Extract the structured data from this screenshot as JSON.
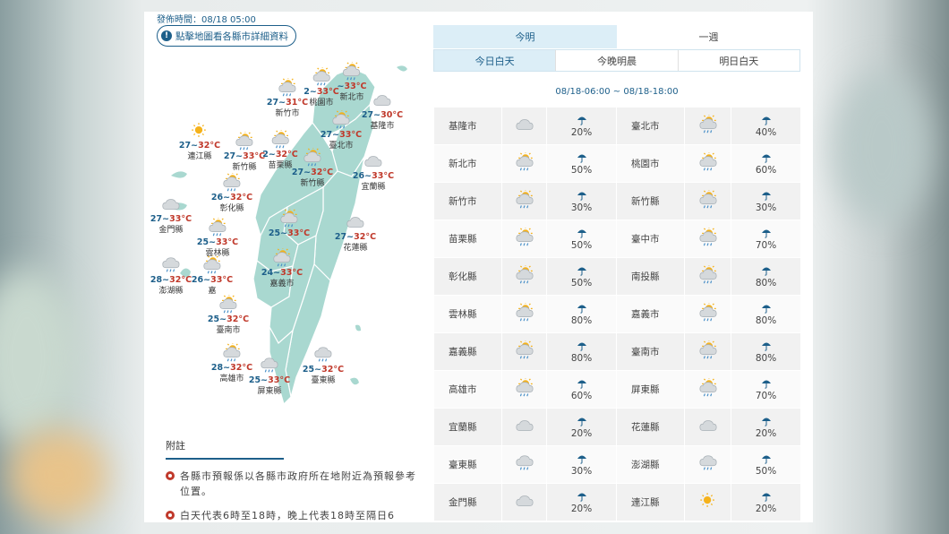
{
  "issue_time": "發佈時間：08/18 05:00",
  "map_hint": "點擊地圖看各縣市詳細資料",
  "tabs_top": [
    {
      "label": "今明",
      "active": true
    },
    {
      "label": "一週",
      "active": false
    }
  ],
  "tabs_period": [
    {
      "label": "今日白天",
      "active": true
    },
    {
      "label": "今晚明晨",
      "active": false
    },
    {
      "label": "明日白天",
      "active": false
    }
  ],
  "time_range": "08/18-06:00 ~ 08/18-18:00",
  "map_cities": [
    {
      "name": "新竹市",
      "lo": "27",
      "hi": "31",
      "icon": "sun-cloud-rain-icon"
    },
    {
      "name": "桃園市",
      "lo": "2",
      "hi": "33",
      "icon": "sun-cloud-rain-icon"
    },
    {
      "name": "新北市",
      "lo": "",
      "hi": "33",
      "icon": "sun-cloud-rain-icon"
    },
    {
      "name": "基隆市",
      "lo": "27",
      "hi": "30",
      "icon": "cloud-icon"
    },
    {
      "name": "臺北市",
      "lo": "27",
      "hi": "33",
      "icon": "sun-cloud-rain-icon"
    },
    {
      "name": "連江縣",
      "lo": "27",
      "hi": "32",
      "icon": "sun-icon"
    },
    {
      "name": "新竹縣",
      "lo": "27",
      "hi": "33",
      "icon": "sun-cloud-rain-icon"
    },
    {
      "name": "苗栗縣",
      "lo": "2",
      "hi": "32",
      "icon": "sun-cloud-rain-icon"
    },
    {
      "name": "新竹縣",
      "lo": "27",
      "hi": "32",
      "icon": "sun-cloud-rain-icon"
    },
    {
      "name": "宜蘭縣",
      "lo": "26",
      "hi": "33",
      "icon": "cloud-icon"
    },
    {
      "name": "彰化縣",
      "lo": "26",
      "hi": "32",
      "icon": "sun-cloud-rain-icon"
    },
    {
      "name": "金門縣",
      "lo": "27",
      "hi": "33",
      "icon": "cloud-icon"
    },
    {
      "name": "雲林縣",
      "lo": "25",
      "hi": "33",
      "icon": "sun-cloud-rain-icon"
    },
    {
      "name": "",
      "lo": "25",
      "hi": "33",
      "icon": "sun-cloud-rain-icon"
    },
    {
      "name": "花蓮縣",
      "lo": "27",
      "hi": "32",
      "icon": "cloud-icon"
    },
    {
      "name": "澎湖縣",
      "lo": "28",
      "hi": "32",
      "icon": "cloud-rain-icon"
    },
    {
      "name": "嘉",
      "lo": "26",
      "hi": "33",
      "icon": "sun-cloud-rain-icon"
    },
    {
      "name": "嘉義市",
      "lo": "24",
      "hi": "33",
      "icon": "sun-cloud-rain-icon"
    },
    {
      "name": "臺南市",
      "lo": "25",
      "hi": "32",
      "icon": "sun-cloud-rain-icon"
    },
    {
      "name": "高雄市",
      "lo": "28",
      "hi": "32",
      "icon": "sun-cloud-rain-icon"
    },
    {
      "name": "屏東縣",
      "lo": "25",
      "hi": "33",
      "icon": "cloud-rain-icon"
    },
    {
      "name": "臺東縣",
      "lo": "25",
      "hi": "32",
      "icon": "cloud-rain-icon"
    }
  ],
  "notes_title": "附註",
  "notes": [
    "各縣市預報係以各縣市政府所在地附近為預報參考位置。",
    "白天代表6時至18時，晚上代表18時至隔日6"
  ],
  "forecast_rows": [
    [
      {
        "name": "基隆市",
        "icon": "cloud-icon",
        "pop": "20%"
      },
      {
        "name": "臺北市",
        "icon": "sun-cloud-rain-icon",
        "pop": "40%"
      }
    ],
    [
      {
        "name": "新北市",
        "icon": "sun-cloud-rain-icon",
        "pop": "50%"
      },
      {
        "name": "桃園市",
        "icon": "sun-cloud-rain-icon",
        "pop": "60%"
      }
    ],
    [
      {
        "name": "新竹市",
        "icon": "sun-cloud-rain-icon",
        "pop": "30%"
      },
      {
        "name": "新竹縣",
        "icon": "sun-cloud-rain-icon",
        "pop": "30%"
      }
    ],
    [
      {
        "name": "苗栗縣",
        "icon": "sun-cloud-rain-icon",
        "pop": "50%"
      },
      {
        "name": "臺中市",
        "icon": "sun-cloud-rain-icon",
        "pop": "70%"
      }
    ],
    [
      {
        "name": "彰化縣",
        "icon": "sun-cloud-rain-icon",
        "pop": "50%"
      },
      {
        "name": "南投縣",
        "icon": "sun-cloud-rain-icon",
        "pop": "80%"
      }
    ],
    [
      {
        "name": "雲林縣",
        "icon": "sun-cloud-rain-icon",
        "pop": "80%"
      },
      {
        "name": "嘉義市",
        "icon": "sun-cloud-rain-icon",
        "pop": "80%"
      }
    ],
    [
      {
        "name": "嘉義縣",
        "icon": "sun-cloud-rain-icon",
        "pop": "80%"
      },
      {
        "name": "臺南市",
        "icon": "sun-cloud-rain-icon",
        "pop": "80%"
      }
    ],
    [
      {
        "name": "高雄市",
        "icon": "sun-cloud-rain-icon",
        "pop": "60%"
      },
      {
        "name": "屏東縣",
        "icon": "sun-cloud-rain-icon",
        "pop": "70%"
      }
    ],
    [
      {
        "name": "宜蘭縣",
        "icon": "cloud-icon",
        "pop": "20%"
      },
      {
        "name": "花蓮縣",
        "icon": "cloud-icon",
        "pop": "20%"
      }
    ],
    [
      {
        "name": "臺東縣",
        "icon": "cloud-rain-icon",
        "pop": "30%"
      },
      {
        "name": "澎湖縣",
        "icon": "cloud-rain-icon",
        "pop": "50%"
      }
    ],
    [
      {
        "name": "金門縣",
        "icon": "cloud-icon",
        "pop": "20%"
      },
      {
        "name": "連江縣",
        "icon": "sun-icon",
        "pop": "20%"
      }
    ]
  ],
  "colors": {
    "accent": "#1d5f8a",
    "high_temp": "#c0392b",
    "map_land": "#a9d8d0",
    "tab_active_bg": "#dceef7"
  }
}
